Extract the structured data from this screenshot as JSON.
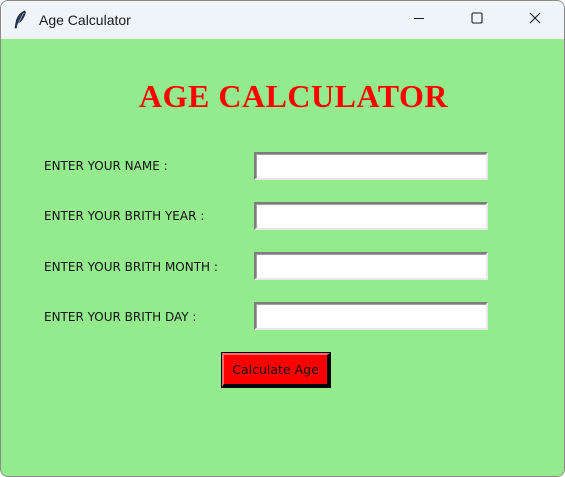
{
  "window": {
    "title": "Age Calculator",
    "app_icon": "feather-icon",
    "controls": {
      "minimize_icon": "minimize-icon",
      "maximize_icon": "maximize-icon",
      "close_icon": "close-icon"
    }
  },
  "colors": {
    "background": "#93eb8e",
    "heading": "#ff0000",
    "button": "#ff0000",
    "titlebar": "#eff4f9"
  },
  "heading": "AGE CALCULATOR",
  "form": {
    "name_label": "ENTER YOUR NAME :",
    "name_value": "",
    "year_label": "ENTER YOUR BRITH YEAR :",
    "year_value": "",
    "month_label": "ENTER YOUR BRITH MONTH :",
    "month_value": "",
    "day_label": "ENTER YOUR BRITH DAY :",
    "day_value": ""
  },
  "calculate_button": "Calculate Age"
}
